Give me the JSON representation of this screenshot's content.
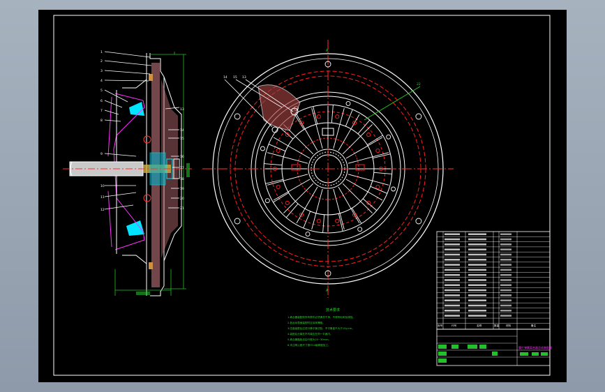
{
  "drawing": {
    "section_view": {
      "part_numbers_left": [
        "1",
        "2",
        "3",
        "4",
        "5",
        "6",
        "7",
        "8",
        "9",
        "10",
        "11",
        "12"
      ],
      "part_numbers_right": [
        "13",
        "14",
        "15",
        "16",
        "17",
        "18",
        "19",
        "20",
        "21"
      ]
    },
    "front_view": {
      "callouts": [
        "14",
        "15",
        "13"
      ],
      "callout_right": "22"
    },
    "tech_requirements": {
      "title": "技术要求",
      "lines": [
        "1.离合器装配前所有零件必须清洗干净，不得有毛刺及锈蚀。",
        "2.各运动表面装配时应涂润滑脂。",
        "3.压盘装配后应进行静平衡试验，不平衡量不大于15g·cm。",
        "4.装配后分离杠杆内端应在同一平面内。",
        "5.离合器踏板自由行程为20~30mm。",
        "6.未注明公差尺寸按IT14级精度加工。"
      ]
    },
    "title_block": {
      "drawing_title": "膜片弹簧离合器总成装配图",
      "header": [
        "序号",
        "代号",
        "名称",
        "数量",
        "材料",
        "备注"
      ]
    }
  },
  "colors": {
    "background": "#000000",
    "outline": "#ffffff",
    "hidden": "#ff2020",
    "centerline": "#ff3030",
    "accent_cyan": "#00e5ff",
    "accent_green": "#22dd22",
    "dim_green": "#22c02a",
    "magenta": "#ff30ff"
  }
}
